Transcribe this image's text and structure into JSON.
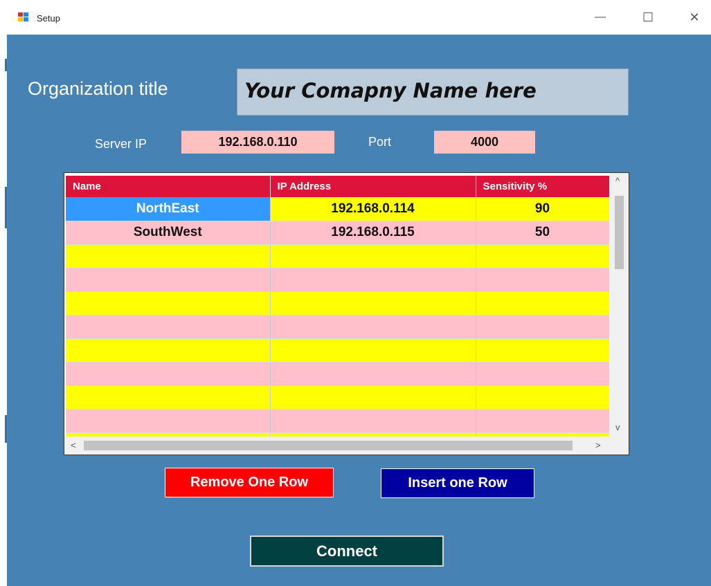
{
  "window": {
    "title": "Setup",
    "minimize_glyph": "—",
    "maximize_glyph": "☐",
    "close_glyph": "✕"
  },
  "form": {
    "org_label": "Organization title",
    "org_value": "Your Comapny Name here",
    "server_ip_label": "Server IP",
    "server_ip_value": "192.168.0.110",
    "port_label": "Port",
    "port_value": "4000"
  },
  "grid": {
    "columns": [
      "Name",
      "IP Address",
      "Sensitivity %"
    ],
    "rows": [
      {
        "name": "NorthEast",
        "ip": "192.168.0.114",
        "sensitivity": "90",
        "color": "yellow",
        "selected_name": true
      },
      {
        "name": "SouthWest",
        "ip": "192.168.0.115",
        "sensitivity": "50",
        "color": "pink"
      },
      {
        "name": "",
        "ip": "",
        "sensitivity": "",
        "color": "yellow"
      },
      {
        "name": "",
        "ip": "",
        "sensitivity": "",
        "color": "pink"
      },
      {
        "name": "",
        "ip": "",
        "sensitivity": "",
        "color": "yellow"
      },
      {
        "name": "",
        "ip": "",
        "sensitivity": "",
        "color": "pink"
      },
      {
        "name": "",
        "ip": "",
        "sensitivity": "",
        "color": "yellow"
      },
      {
        "name": "",
        "ip": "",
        "sensitivity": "",
        "color": "pink"
      },
      {
        "name": "",
        "ip": "",
        "sensitivity": "",
        "color": "yellow"
      },
      {
        "name": "",
        "ip": "",
        "sensitivity": "",
        "color": "pink"
      },
      {
        "name": "",
        "ip": "",
        "sensitivity": "",
        "color": "yellow"
      }
    ]
  },
  "buttons": {
    "remove_row": "Remove One Row",
    "insert_row": "Insert one Row",
    "connect": "Connect"
  },
  "colors": {
    "form_background": "#4682b4",
    "header_background": "#dc143c",
    "row_yellow": "#ffff00",
    "row_pink": "#ffc0cb",
    "selected_cell": "#3399ff",
    "remove_button": "#ff0000",
    "insert_button": "#0000a0",
    "connect_button": "#004040"
  }
}
